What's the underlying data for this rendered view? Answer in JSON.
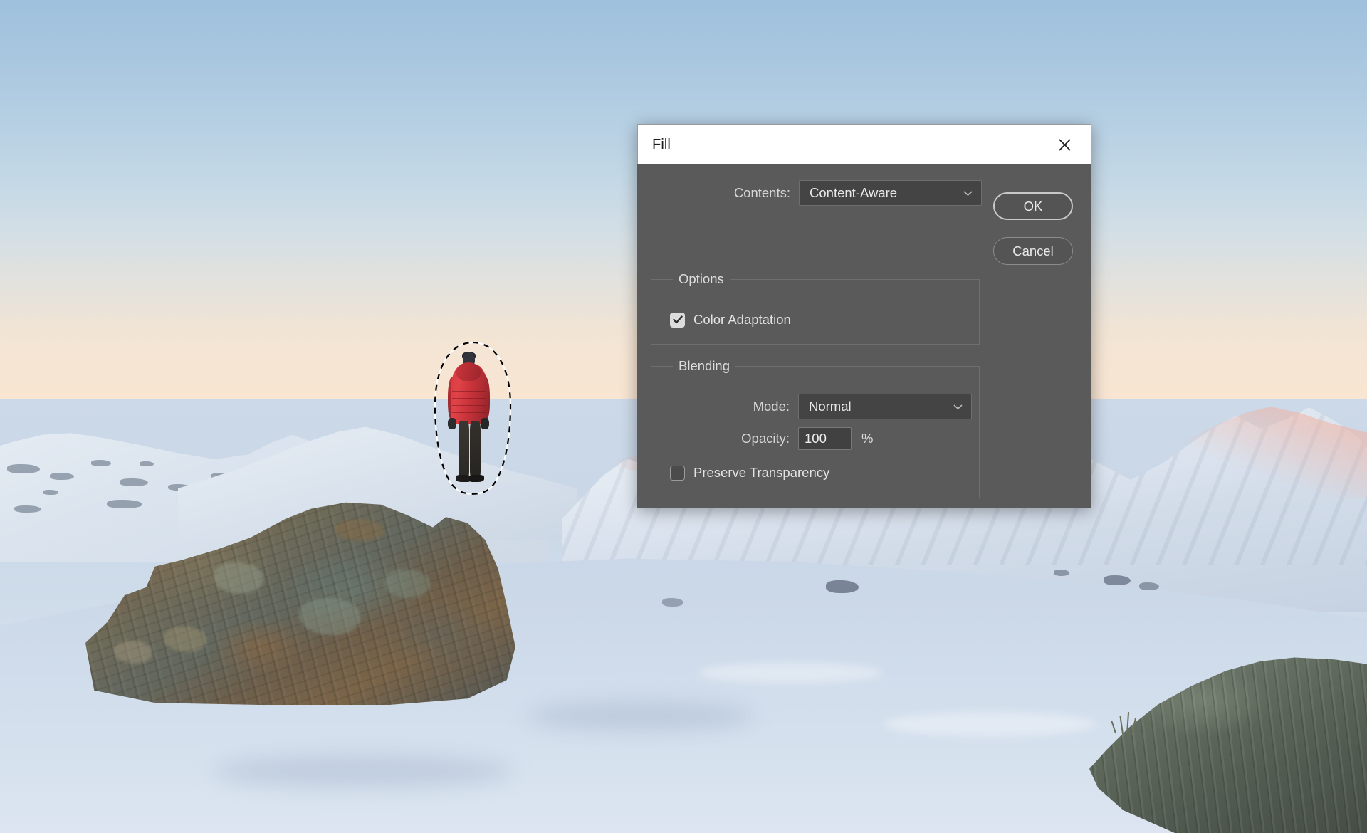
{
  "dialog": {
    "title": "Fill",
    "close_icon": "close-icon",
    "contents": {
      "label": "Contents:",
      "value": "Content-Aware",
      "options": [
        "Content-Aware"
      ]
    },
    "buttons": {
      "ok": "OK",
      "cancel": "Cancel"
    },
    "options_group": {
      "title": "Options",
      "color_adaptation": {
        "label": "Color Adaptation",
        "checked": "true"
      }
    },
    "blending_group": {
      "title": "Blending",
      "mode": {
        "label": "Mode:",
        "value": "Normal",
        "options": [
          "Normal"
        ]
      },
      "opacity": {
        "label": "Opacity:",
        "value": "100",
        "unit": "%"
      },
      "preserve_transparency": {
        "label": "Preserve Transparency",
        "checked": "false"
      }
    }
  },
  "canvas": {
    "description": "alpine snow landscape photo with hiker on boulder",
    "selection": "elliptical-selection-around-hiker",
    "colors": {
      "dialog_background": "#5a5a5a",
      "titlebar_background": "#ffffff",
      "field_background": "#444444",
      "accent_border": "#c9c9c9",
      "jacket_red": "#d63a3f",
      "sky_top": "#9fc0dc",
      "sky_horizon": "#f6e6da",
      "snow": "#ccd9e8",
      "boulder": "#7a6147"
    }
  }
}
